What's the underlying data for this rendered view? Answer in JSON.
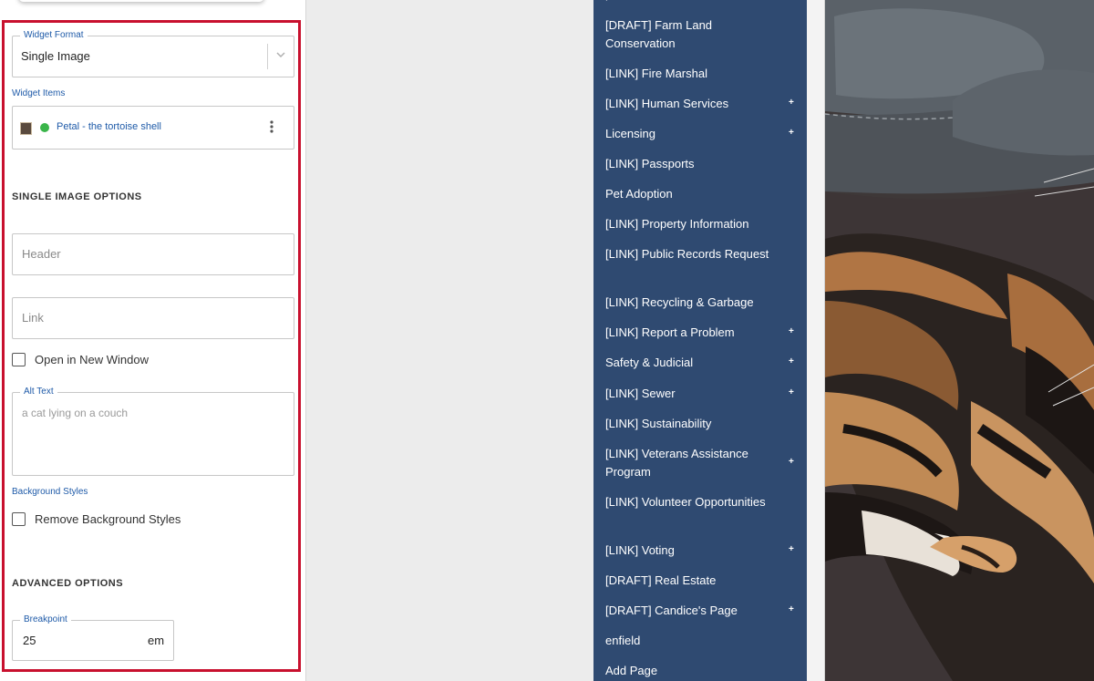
{
  "widget_format": {
    "legend": "Widget Format",
    "value": "Single Image"
  },
  "widget_items": {
    "label": "Widget Items",
    "item": {
      "title": "Petal - the tortoise shell",
      "status_color": "#3ab54a"
    }
  },
  "single_image_options": {
    "heading": "SINGLE IMAGE OPTIONS",
    "header_placeholder": "Header",
    "link_placeholder": "Link",
    "open_new_window_label": "Open in New Window",
    "alt_text": {
      "legend": "Alt Text",
      "value": "a cat lying on a couch"
    }
  },
  "background_styles": {
    "label": "Background Styles",
    "remove_label": "Remove Background Styles"
  },
  "advanced_options": {
    "heading": "ADVANCED OPTIONS",
    "breakpoint": {
      "legend": "Breakpoint",
      "value": "25",
      "unit": "em"
    }
  },
  "nav": {
    "items": [
      {
        "label": "[DRAFT] Farm Land Conservation",
        "has_children": false
      },
      {
        "label": "[LINK] Fire Marshal",
        "has_children": false
      },
      {
        "label": "[LINK] Human Services",
        "has_children": true
      },
      {
        "label": "Licensing",
        "has_children": true
      },
      {
        "label": "[LINK] Passports",
        "has_children": false
      },
      {
        "label": "Pet Adoption",
        "has_children": false
      },
      {
        "label": "[LINK] Property Information",
        "has_children": false
      },
      {
        "label": "[LINK] Public Records Request",
        "has_children": false
      },
      {
        "label": "[LINK] Recycling & Garbage",
        "has_children": false
      },
      {
        "label": "[LINK] Report a Problem",
        "has_children": true
      },
      {
        "label": "Safety & Judicial",
        "has_children": true
      },
      {
        "label": "[LINK] Sewer",
        "has_children": true
      },
      {
        "label": "[LINK] Sustainability",
        "has_children": false
      },
      {
        "label": "[LINK] Veterans Assistance Program",
        "has_children": true
      },
      {
        "label": "[LINK] Volunteer Opportunities",
        "has_children": false
      },
      {
        "label": "[LINK] Voting",
        "has_children": true
      },
      {
        "label": "[DRAFT] Real Estate",
        "has_children": false
      },
      {
        "label": "[DRAFT] Candice's Page",
        "has_children": true
      },
      {
        "label": "enfield",
        "has_children": false
      },
      {
        "label": "Add Page",
        "has_children": false
      }
    ],
    "plus_symbol": "+",
    "background": "#2f4a71"
  },
  "colors": {
    "frame": "#c8102e",
    "accent": "#1e5aa8"
  }
}
